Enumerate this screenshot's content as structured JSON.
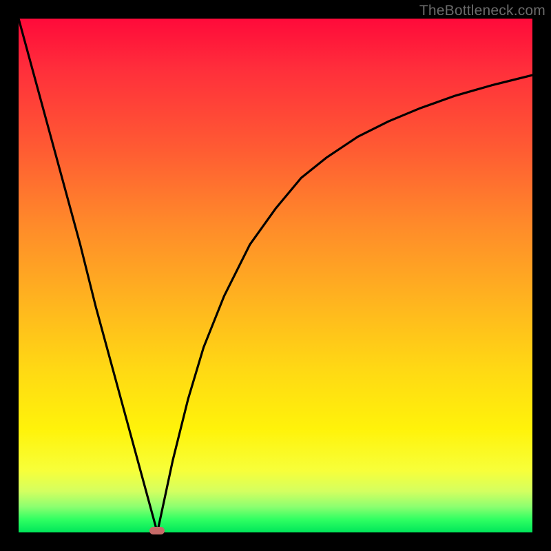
{
  "watermark": "TheBottleneck.com",
  "colors": {
    "frame": "#000000",
    "gradient_top": "#ff0a3a",
    "gradient_bottom": "#00e65a",
    "curve": "#000000",
    "marker": "#c76a68"
  },
  "chart_data": {
    "type": "line",
    "title": "",
    "xlabel": "",
    "ylabel": "",
    "xlim": [
      0,
      100
    ],
    "ylim": [
      0,
      100
    ],
    "annotations": [
      {
        "name": "marker",
        "x": 27,
        "y": 0,
        "shape": "pill"
      }
    ],
    "series": [
      {
        "name": "left-branch",
        "x": [
          0,
          3,
          6,
          9,
          12,
          15,
          18,
          21,
          24,
          27
        ],
        "values": [
          100,
          89,
          78,
          67,
          56,
          44,
          33,
          22,
          11,
          0
        ]
      },
      {
        "name": "right-branch",
        "x": [
          27,
          30,
          33,
          36,
          40,
          45,
          50,
          55,
          60,
          66,
          72,
          78,
          85,
          92,
          100
        ],
        "values": [
          0,
          14,
          26,
          36,
          46,
          56,
          63,
          69,
          73,
          77,
          80,
          82.5,
          85,
          87,
          89
        ]
      }
    ]
  }
}
